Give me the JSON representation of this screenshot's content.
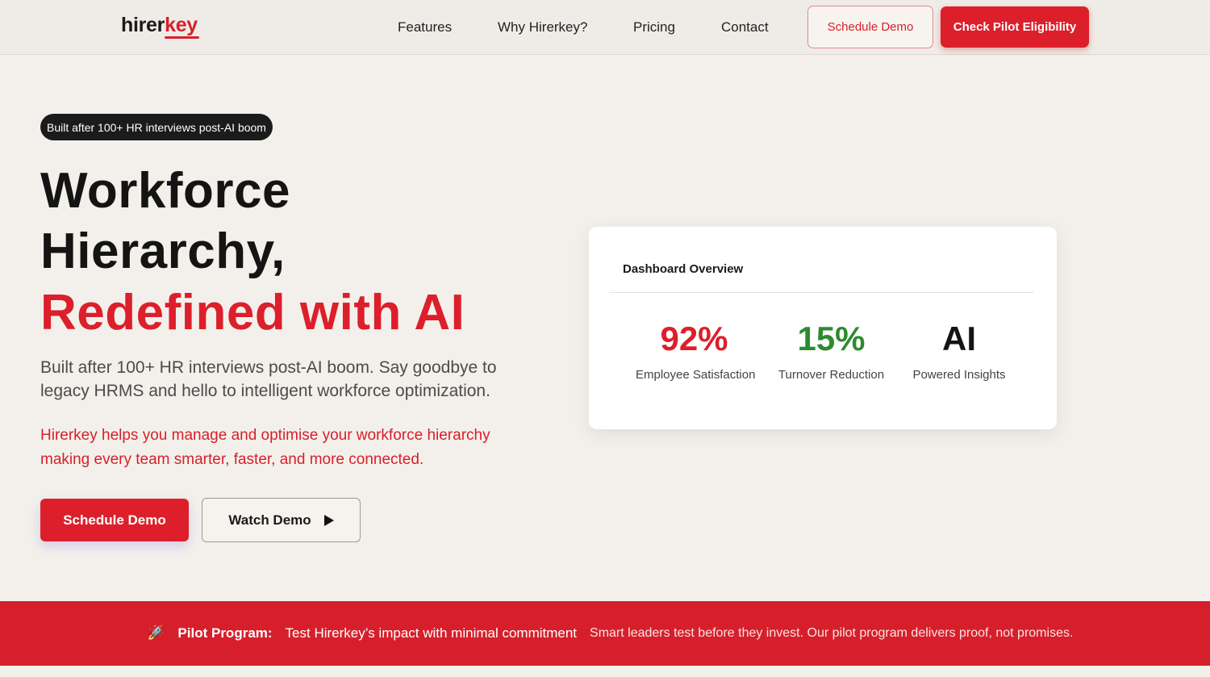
{
  "nav": {
    "logo_part1": "hirer",
    "logo_part2": "key",
    "links": [
      "Features",
      "Why Hirerkey?",
      "Pricing",
      "Contact"
    ],
    "schedule_demo": "Schedule Demo",
    "check_eligibility": "Check Pilot Eligibility"
  },
  "hero": {
    "badge": "Built after 100+ HR interviews post-AI boom",
    "title_line1": "Workforce",
    "title_line2": "Hierarchy,",
    "title_line3": "Redefined with AI",
    "lead": "Built after 100+ HR interviews post-AI boom. Say goodbye to legacy HRMS and hello to intelligent workforce optimization.",
    "lead_red": "Hirerkey helps you manage and optimise your workforce hierarchy making every team smarter, faster, and more connected.",
    "primary_button": "Schedule Demo",
    "secondary_button": "Watch Demo"
  },
  "dashboard": {
    "title": "Dashboard Overview",
    "stats": [
      {
        "value": "92%",
        "label": "Employee Satisfaction",
        "color": "#dc1f2b"
      },
      {
        "value": "15%",
        "label": "Turnover Reduction",
        "color": "#2e8a2e"
      },
      {
        "value": "AI",
        "label": "Powered Insights",
        "color": "#141414"
      }
    ]
  },
  "banner": {
    "icon": "🚀",
    "label": "Pilot Program:",
    "subtitle": "Test Hirerkey’s impact with minimal commitment",
    "description": "Smart leaders test before they invest. Our pilot program delivers proof, not promises."
  },
  "colors": {
    "brand_red": "#dc1f2b",
    "accent_green": "#2e8a2e",
    "background": "#f3f0eb"
  }
}
